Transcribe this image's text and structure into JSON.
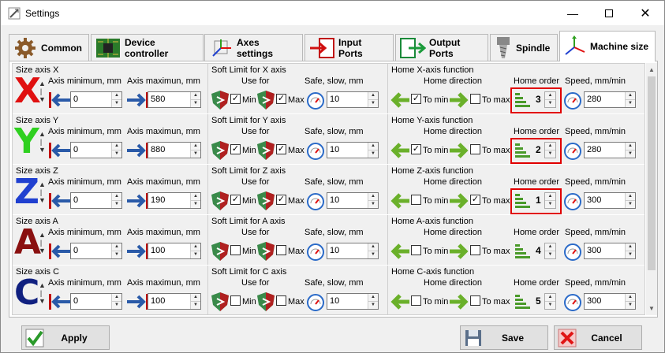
{
  "window": {
    "title": "Settings"
  },
  "tabs": [
    {
      "label": "Common",
      "icon": "gear-icon",
      "active": false
    },
    {
      "label": "Device controller",
      "icon": "circuit-board-icon",
      "active": false
    },
    {
      "label": "Axes settings",
      "icon": "axes-icon",
      "active": false
    },
    {
      "label": "Input Ports",
      "icon": "input-port-icon",
      "active": false
    },
    {
      "label": "Output Ports",
      "icon": "output-port-icon",
      "active": false
    },
    {
      "label": "Spindle",
      "icon": "spindle-icon",
      "active": false
    },
    {
      "label": "Machine size",
      "icon": "xyz-axes-icon",
      "active": true
    }
  ],
  "labels": {
    "axis_min": "Axis minimum, mm",
    "axis_max": "Axis maximun, mm",
    "use_for": "Use for",
    "safe_slow": "Safe, slow, mm",
    "home_direction": "Home direction",
    "home_order": "Home order",
    "speed": "Speed, mm/min",
    "min": "Min",
    "max": "Max",
    "to_min": "To min",
    "to_max": "To max"
  },
  "axes": [
    {
      "letter": "X",
      "color": "#e01010",
      "size_title": "Size axis X",
      "min": "0",
      "max": "580",
      "soft_title": "Soft Limit for X axis",
      "soft_min": true,
      "soft_max": true,
      "safe": "10",
      "home_title": "Home X-axis function",
      "to_min": true,
      "to_max": false,
      "order": "3",
      "speed": "280",
      "highlight": true
    },
    {
      "letter": "Y",
      "color": "#2fd020",
      "size_title": "Size axis Y",
      "min": "0",
      "max": "880",
      "soft_title": "Soft Limit for Y axis",
      "soft_min": true,
      "soft_max": true,
      "safe": "10",
      "home_title": "Home Y-axis function",
      "to_min": true,
      "to_max": false,
      "order": "2",
      "speed": "280",
      "highlight": true
    },
    {
      "letter": "Z",
      "color": "#2040d0",
      "size_title": "Size axis Z",
      "min": "0",
      "max": "190",
      "soft_title": "Soft Limit for Z axis",
      "soft_min": true,
      "soft_max": true,
      "safe": "10",
      "home_title": "Home Z-axis function",
      "to_min": false,
      "to_max": true,
      "order": "1",
      "speed": "300",
      "highlight": true
    },
    {
      "letter": "A",
      "color": "#8a1010",
      "size_title": "Size axis A",
      "min": "0",
      "max": "100",
      "soft_title": "Soft Limit for A axis",
      "soft_min": false,
      "soft_max": false,
      "safe": "10",
      "home_title": "Home A-axis function",
      "to_min": false,
      "to_max": false,
      "order": "4",
      "speed": "300",
      "highlight": false
    },
    {
      "letter": "C",
      "color": "#102080",
      "size_title": "Size axis C",
      "min": "0",
      "max": "100",
      "soft_title": "Soft Limit for C axis",
      "soft_min": false,
      "soft_max": false,
      "safe": "10",
      "home_title": "Home C-axis function",
      "to_min": false,
      "to_max": false,
      "order": "5",
      "speed": "300",
      "highlight": false
    }
  ],
  "buttons": {
    "apply": "Apply",
    "save": "Save",
    "cancel": "Cancel"
  }
}
